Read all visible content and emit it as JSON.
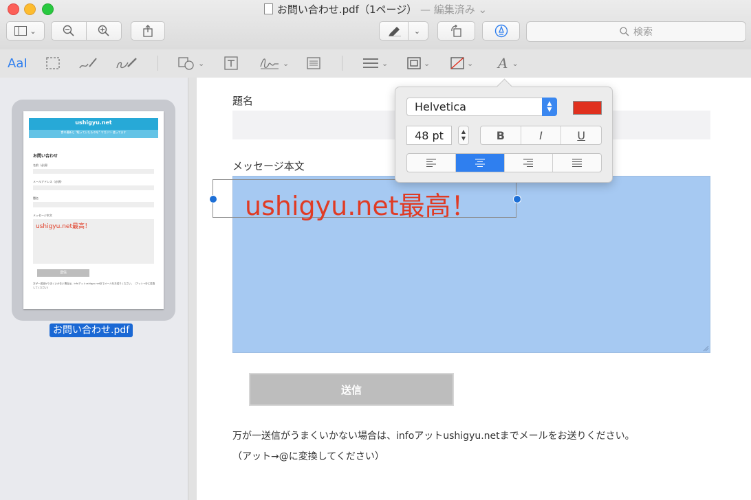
{
  "window": {
    "title": "お問い合わせ.pdf（1ページ）",
    "edited_label": "— 編集済み"
  },
  "toolbar": {
    "search_placeholder": "検索"
  },
  "markup_toolbar": {
    "text_style_label": "AaI"
  },
  "sidebar": {
    "filename": "お問い合わせ.pdf",
    "thumbnail": {
      "site_name": "ushigyu.net",
      "tagline": "食の最新と \"眠っていたものを\" マガジン 使ってます",
      "page_heading": "お問い合わせ",
      "field_labels": [
        "名前（必須）",
        "メールアドレス（必須）",
        "題名",
        "メッセージ本文"
      ],
      "message_text": "ushigyu.net最高！",
      "button_label": "送信",
      "note": "万が一送信がうまくいかない場合は、infoアットushigyu.netまでメールをお送りください。（アット→@に変換してください）"
    }
  },
  "document": {
    "subject_label": "題名",
    "message_label": "メッセージ本文",
    "annotation_text": "ushigyu.net最高！",
    "submit_label": "送信",
    "note_line1": "万が一送信がうまくいかない場合は、infoアットushigyu.netまでメールをお送りください。",
    "note_line2": "（アット→@に変換してください）"
  },
  "text_popover": {
    "font_name": "Helvetica",
    "font_size": "48 pt",
    "text_color": "#e0301e",
    "bold_label": "B",
    "italic_label": "I",
    "underline_label": "U",
    "alignments": [
      "left",
      "center",
      "right",
      "justify"
    ],
    "selected_alignment": "center"
  },
  "colors": {
    "accent": "#2f7fef",
    "selection": "#a6c9f2",
    "annotation": "#e03b24"
  }
}
